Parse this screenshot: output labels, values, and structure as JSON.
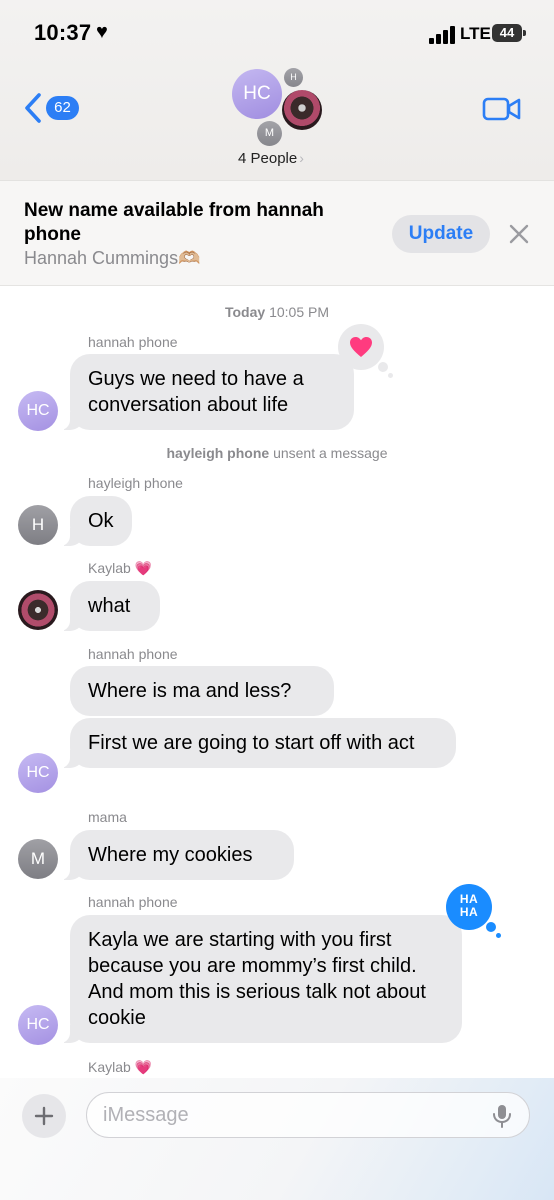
{
  "status": {
    "time": "10:37",
    "network": "LTE",
    "battery": "44"
  },
  "header": {
    "back_count": "62",
    "avatar_main_initials": "HC",
    "avatar_small_h": "H",
    "avatar_small_m": "M",
    "people_label": "4 People",
    "people_chevron": "›"
  },
  "banner": {
    "title": "New name available from hannah phone",
    "subtitle": "Hannah Cummings🫶🏼",
    "update_label": "Update"
  },
  "conversation": {
    "timestamp_day": "Today",
    "timestamp_time": "10:05 PM",
    "system_actor": "hayleigh phone",
    "system_text": "unsent a message"
  },
  "messages": [
    {
      "sender": "hannah phone",
      "text": "Guys we need to have a conversation about life",
      "avatar": "HC",
      "tapback": "heart"
    },
    {
      "sender": "hayleigh phone",
      "text": "Ok",
      "avatar": "H"
    },
    {
      "sender": "Kaylab 💗",
      "text": "what",
      "avatar": ""
    },
    {
      "sender": "hannah phone",
      "text": "Where is ma and less?"
    },
    {
      "text": "First we are going to start off with act",
      "avatar": "HC"
    },
    {
      "sender": "mama",
      "text": "Where my cookies",
      "avatar": "M"
    },
    {
      "sender": "hannah phone",
      "text": "Kayla we are starting with you first because you are mommy’s first child. And mom this is serious talk not about cookie",
      "avatar": "HC",
      "tapback": "haha"
    },
    {
      "sender": "Kaylab 💗"
    }
  ],
  "tapbacks": {
    "heart": "♥",
    "haha_line1": "HA",
    "haha_line2": "HA"
  },
  "input": {
    "placeholder": "iMessage",
    "value": ""
  },
  "colors": {
    "accent": "#2c7ef5",
    "bubble": "#e9e9eb",
    "heart": "#ff3b7f",
    "haha": "#1a8cff"
  }
}
